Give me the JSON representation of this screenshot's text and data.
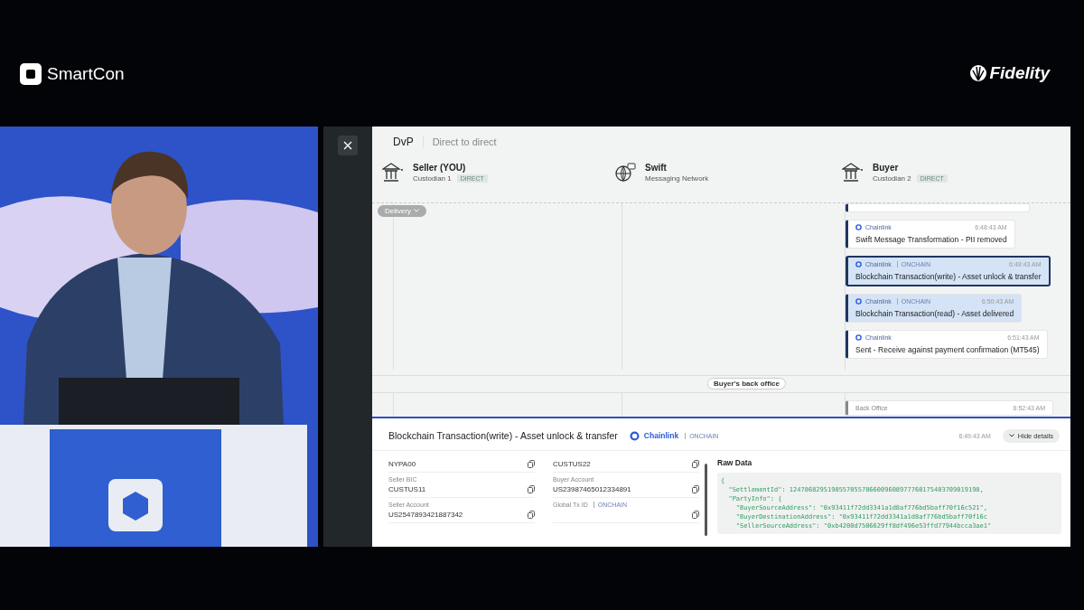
{
  "event_logo": {
    "text": "SmartCon"
  },
  "sponsor_logo": {
    "text": "Fidelity"
  },
  "app": {
    "breadcrumb": {
      "title": "DvP",
      "subtitle": "Direct to direct"
    },
    "participants": [
      {
        "name": "Seller (YOU)",
        "subtitle": "Custodian 1",
        "badge": "DIRECT",
        "kind": "bank"
      },
      {
        "name": "Swift",
        "subtitle": "Messaging Network",
        "kind": "network"
      },
      {
        "name": "Buyer",
        "subtitle": "Custodian 2",
        "badge": "DIRECT",
        "kind": "bank"
      }
    ],
    "phase_filter": "Delivery",
    "events": [
      {
        "source": "Chainlink",
        "time": "6:48:43 AM",
        "message": "Swift Message Transformation - PII removed",
        "kind": "offchain",
        "selected": false
      },
      {
        "source": "Chainlink",
        "tag": "ONCHAIN",
        "time": "6:49:43 AM",
        "message": "Blockchain Transaction(write) - Asset unlock & transfer",
        "kind": "onchain",
        "selected": true
      },
      {
        "source": "Chainlink",
        "tag": "ONCHAIN",
        "time": "6:50:43 AM",
        "message": "Blockchain Transaction(read) - Asset delivered",
        "kind": "onchain",
        "selected": false
      },
      {
        "source": "Chainlink",
        "time": "6:51:43 AM",
        "message": "Sent - Receive against payment confirmation (MT545)",
        "kind": "offchain",
        "selected": false
      }
    ],
    "divider_label": "Buyer's back office",
    "back_office_event": {
      "source": "Back Office",
      "time": "6:52:43 AM"
    },
    "details": {
      "title": "Blockchain Transaction(write) - Asset unlock & transfer",
      "source": "Chainlink",
      "tag": "ONCHAIN",
      "time": "6:49:43 AM",
      "toggle": "Hide details",
      "fields": [
        {
          "value": "NYPA00"
        },
        {
          "value": "CUSTUS22"
        },
        {
          "label": "Seller BIC",
          "value": "CUSTUS11"
        },
        {
          "label": "Buyer Account",
          "value": "US23987465012334891"
        },
        {
          "label": "Seller Account",
          "value": "US2547893421887342"
        },
        {
          "label": "Global Tx ID",
          "tag": "ONCHAIN"
        }
      ],
      "raw_data_title": "Raw Data",
      "raw_data_lines": [
        "{",
        "  \"SettlementId\": 12478682951905570557866009608977760175403709019198,",
        "  \"PartyInfo\": {",
        "    \"BuyerSourceAddress\": \"0x93411f72dd3341a1d8af776bd5baff70f16c521\",",
        "    \"BuyerDestinationAddress\": \"0x93411f72dd3341a1d8af776bd5baff70f16c",
        "    \"SellerSourceAddress\": \"0xb4200d7506629ff8df496e53ffd77944bcca3ae1\""
      ]
    }
  }
}
